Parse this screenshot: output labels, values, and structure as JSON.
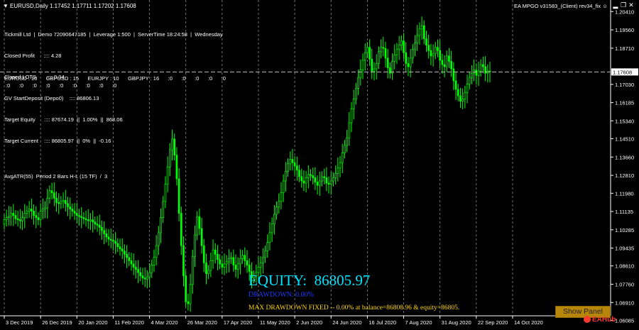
{
  "window": {
    "title": "EURUSD,Daily  1.17452 1.17711 1.17202 1.17608",
    "ea_label": "EA MPGO v31583_(Client) rev34_fix"
  },
  "info_panel": {
    "lines": [
      "Tickmill Ltd  |  Demo 72090647185  |  Leverage 1:500  |  ServerTime 18:24:58  |  Wednesday",
      "Closed Profit      :::: 4.28",
      "Closed LOTS       :::: 0.04",
      "GV StartDeposit (Depo0)    :::: 86806.13",
      "Target Equity      :::: 87674.19  ||  1.00%  ||  868.06",
      "Target Current    :::: 86805.97  ||  0%  ||  -0.16",
      "",
      "AvgATR(55)  Period 2 Bars H-L (15 TF)  /  3"
    ],
    "pairs_line": "EURUSD : 10      GBPUSD : 15      EURJPY : 10      GBPJPY : 16      :0      :0      :0      :0      :0",
    "zeros_line": ":0      :0      :0      :0      :0      :0      :0      :0      :0"
  },
  "equity": {
    "label": "EQUITY:",
    "value": "86805.97",
    "drawdown": "DRAWDOWN: 0.00%",
    "max_drawdown": "MAX DRAWDOWN FIXED -- 0.00% at balance=86808.96 & equity=86805."
  },
  "buttons": {
    "show_panel": "Show Panel"
  },
  "watermark": "EAHub",
  "colors": {
    "background": "#000000",
    "bull": "#00ff00",
    "grid": "#8a8a8a",
    "equity": "#00e5ff",
    "drawdown": "#1e3cff",
    "max_dd": "#ffd700",
    "current_price_box": "#ffffff"
  },
  "chart_data": {
    "type": "candlestick",
    "symbol": "EURUSD",
    "timeframe": "Daily",
    "current_price": "1.17608",
    "ylim": [
      1.0636,
      1.2088
    ],
    "y_ticks": [
      "1.20410",
      "1.19560",
      "1.18710",
      "1.17608",
      "1.17030",
      "1.16185",
      "1.15340",
      "1.14510",
      "1.13660",
      "1.12810",
      "1.11980",
      "1.11135",
      "1.10285",
      "1.09435",
      "1.08610",
      "1.07760",
      "1.06910",
      "1.06085"
    ],
    "y_tick_values": [
      1.2041,
      1.1956,
      1.1871,
      1.17608,
      1.1703,
      1.16185,
      1.1534,
      1.1451,
      1.1366,
      1.1281,
      1.1198,
      1.11135,
      1.10285,
      1.09435,
      1.0861,
      1.0776,
      1.0691,
      1.06085
    ],
    "x_ticks": [
      "3 Dec 2019",
      "26 Dec 2019",
      "20 Jan 2020",
      "11 Feb 2020",
      "4 Mar 2020",
      "26 Mar 2020",
      "17 Apr 2020",
      "11 May 2020",
      "2 Jun 2020",
      "24 Jun 2020",
      "16 Jul 2020",
      "7 Aug 2020",
      "31 Aug 2020",
      "22 Sep 2020",
      "14 Oct 2020"
    ],
    "x_tick_index": [
      0,
      16,
      32,
      48,
      64,
      80,
      96,
      112,
      128,
      144,
      160,
      176,
      192,
      208,
      224
    ],
    "closes": [
      1.1075,
      1.1085,
      1.109,
      1.1105,
      1.1095,
      1.108,
      1.1075,
      1.107,
      1.1085,
      1.1105,
      1.1115,
      1.1125,
      1.1115,
      1.1095,
      1.1085,
      1.1075,
      1.1115,
      1.1125,
      1.113,
      1.1175,
      1.121,
      1.12,
      1.1175,
      1.1155,
      1.115,
      1.116,
      1.1165,
      1.115,
      1.1135,
      1.1125,
      1.1115,
      1.1105,
      1.1095,
      1.109,
      1.1085,
      1.108,
      1.1075,
      1.107,
      1.1075,
      1.1065,
      1.1055,
      1.105,
      1.104,
      1.1025,
      1.101,
      1.0995,
      1.0985,
      1.098,
      1.0975,
      1.0965,
      1.095,
      1.094,
      1.093,
      1.0915,
      1.09,
      1.0885,
      1.087,
      1.0855,
      1.0845,
      1.083,
      1.0815,
      1.0805,
      1.08,
      1.081,
      1.083,
      1.0865,
      1.09,
      1.0955,
      1.1015,
      1.1085,
      1.116,
      1.124,
      1.132,
      1.14,
      1.145,
      1.1375,
      1.1265,
      1.1105,
      1.0955,
      1.0815,
      1.0695,
      1.0685,
      1.0775,
      1.0905,
      1.1005,
      1.109,
      1.1035,
      1.0955,
      1.0875,
      1.0825,
      1.084,
      1.0885,
      1.0935,
      1.0915,
      1.089,
      1.087,
      1.0855,
      1.087,
      1.088,
      1.0895,
      1.09,
      1.0865,
      1.0845,
      1.087,
      1.0895,
      1.091,
      1.0885,
      1.0865,
      1.0835,
      1.0805,
      1.0815,
      1.083,
      1.0855,
      1.0875,
      1.09,
      1.093,
      1.097,
      1.1015,
      1.1055,
      1.11,
      1.1135,
      1.116,
      1.12,
      1.1255,
      1.13,
      1.1335,
      1.1355,
      1.134,
      1.1325,
      1.1305,
      1.1275,
      1.1255,
      1.1245,
      1.127,
      1.1285,
      1.128,
      1.127,
      1.125,
      1.1235,
      1.1255,
      1.1275,
      1.127,
      1.1245,
      1.124,
      1.1255,
      1.127,
      1.129,
      1.1315,
      1.134,
      1.1385,
      1.142,
      1.1455,
      1.1525,
      1.159,
      1.1635,
      1.1685,
      1.1735,
      1.177,
      1.1815,
      1.185,
      1.1875,
      1.182,
      1.1765,
      1.1775,
      1.18,
      1.1855,
      1.1875,
      1.187,
      1.1825,
      1.178,
      1.1755,
      1.181,
      1.184,
      1.1865,
      1.1885,
      1.1905,
      1.185,
      1.18,
      1.1785,
      1.1825,
      1.1865,
      1.1895,
      1.193,
      1.196,
      1.1975,
      1.1915,
      1.1885,
      1.186,
      1.1835,
      1.1845,
      1.1875,
      1.186,
      1.1815,
      1.1795,
      1.1785,
      1.1835,
      1.181,
      1.1775,
      1.172,
      1.168,
      1.165,
      1.1625,
      1.1635,
      1.1665,
      1.1705,
      1.1735,
      1.1755,
      1.177,
      1.1745,
      1.1765,
      1.1795,
      1.1785,
      1.1755,
      1.1765,
      1.1761
    ]
  }
}
